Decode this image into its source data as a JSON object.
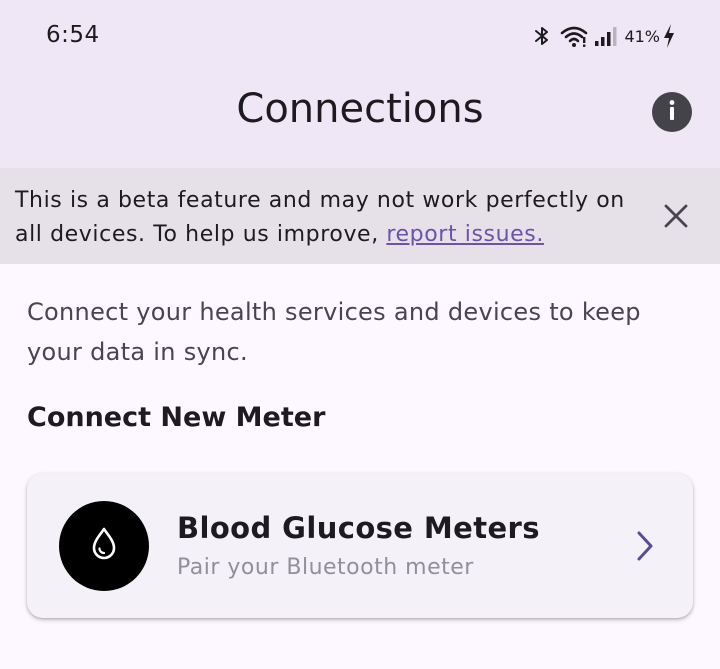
{
  "status_bar": {
    "time": "6:54",
    "battery": "41%",
    "icons": [
      "bluetooth-icon",
      "wifi-icon",
      "signal-icon",
      "battery-charging-icon"
    ]
  },
  "app_bar": {
    "title": "Connections",
    "info_icon": "info-icon"
  },
  "beta_banner": {
    "text": "This is a beta feature and may not work perfectly on all devices. To help us improve, ",
    "link_text": "report issues.",
    "close_icon": "close-icon"
  },
  "intro": {
    "text": "Connect your health services and devices to keep your data in sync."
  },
  "section": {
    "heading": "Connect New Meter"
  },
  "meter_card": {
    "title": "Blood Glucose Meters",
    "subtitle": "Pair your Bluetooth meter",
    "icon": "blood-drop-icon",
    "chevron_icon": "chevron-right-icon"
  },
  "colors": {
    "top_background": "#efe7f5",
    "page_background": "#fdf7ff",
    "banner_background": "#e6e1e8",
    "link": "#6a54a8",
    "card_background": "#f5f1f8",
    "accent": "#5b4d94"
  }
}
